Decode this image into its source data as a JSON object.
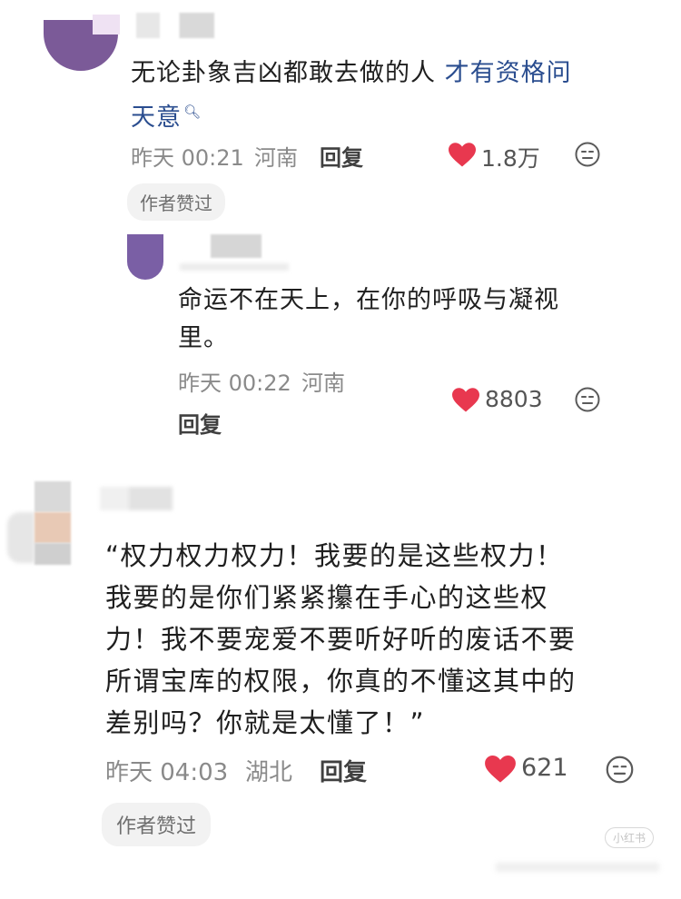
{
  "comments": [
    {
      "text_plain": "无论卦象吉凶都敢去做的人 ",
      "text_link": "才有资格问",
      "text_link2": "天意",
      "time": "昨天 00:21",
      "location": "河南",
      "reply_label": "回复",
      "likes": "1.8万",
      "badge": "作者赞过",
      "reply": {
        "line1": "命运不在天上，在你的呼吸与凝视",
        "line2": "里。",
        "time": "昨天 00:22",
        "location": "河南",
        "reply_label": "回复",
        "likes": "8803"
      }
    },
    {
      "lines": [
        "“权力权力权力！我要的是这些权力！",
        "我要的是你们紧紧攥在手心的这些权",
        "力！我不要宠爱不要听好听的废话不要",
        "所谓宝库的权限，你真的不懂这其中的",
        "差别吗？你就是太懂了！”"
      ],
      "time": "昨天 04:03",
      "location": "湖北",
      "reply_label": "回复",
      "likes": "621",
      "badge": "作者赞过"
    }
  ],
  "watermark": "小红书",
  "colors": {
    "heart": "#e8384f",
    "link": "#2a4d8f",
    "meta": "#8a8a8a"
  }
}
